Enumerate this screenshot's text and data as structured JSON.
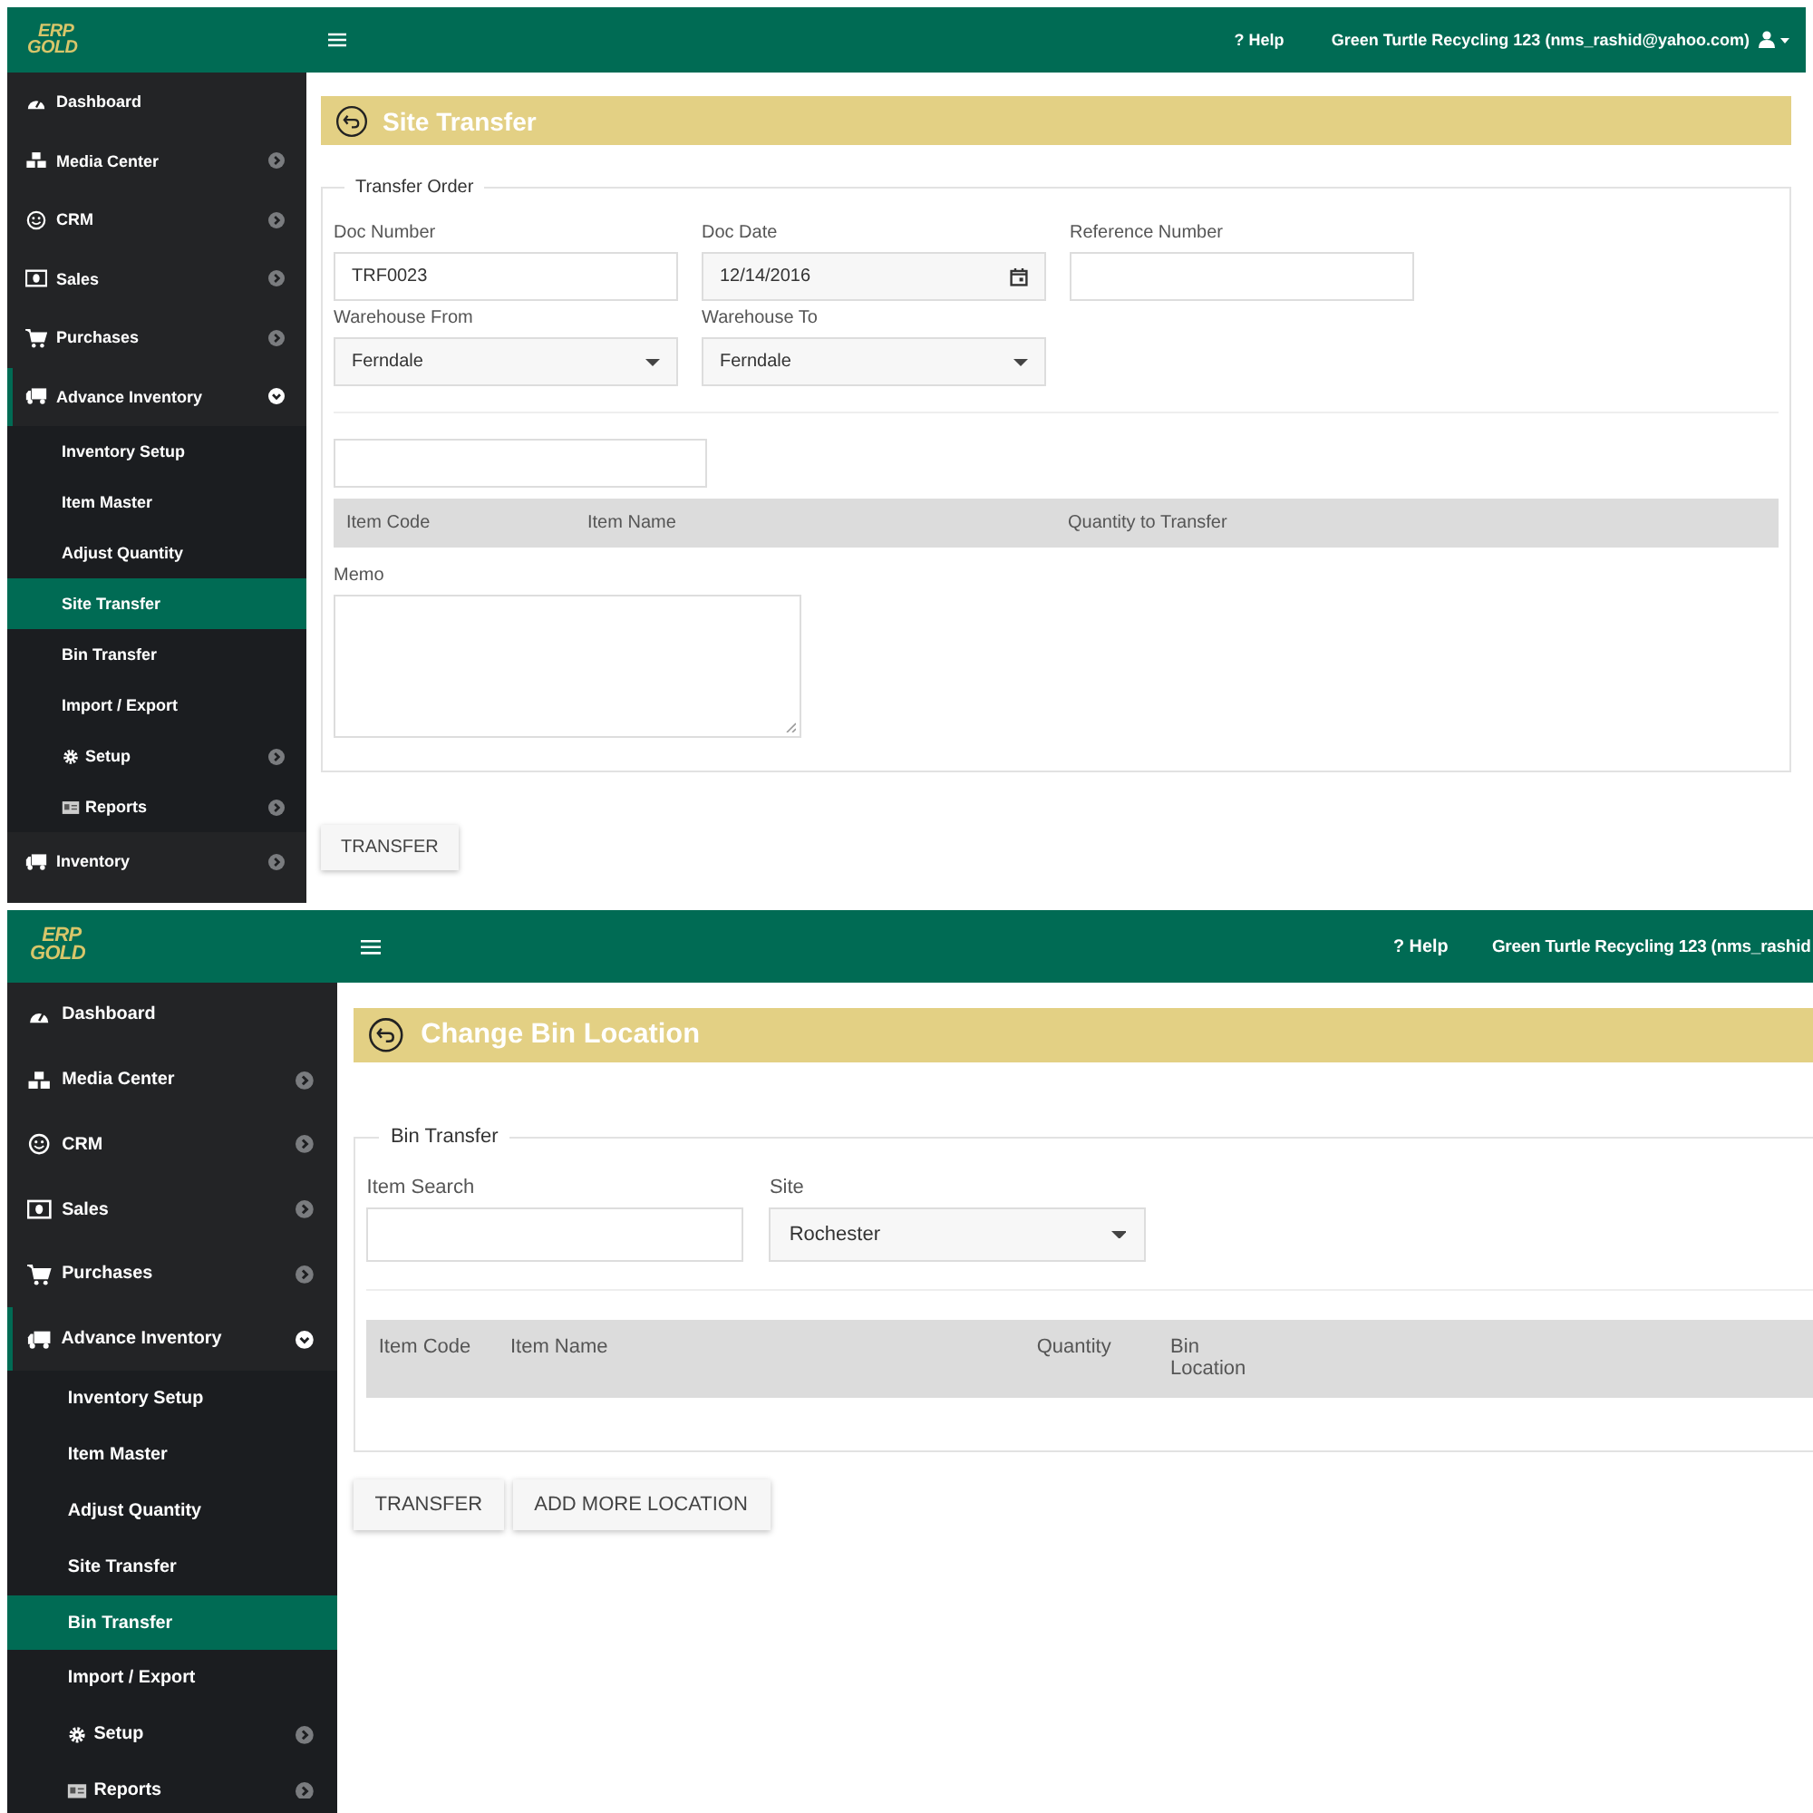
{
  "screens": [
    {
      "logo": [
        "ERP",
        "GOLD"
      ],
      "help_link": "? Help",
      "user": "Green Turtle Recycling 123 (nms_rashid@yahoo.com)",
      "account_menu": true,
      "sidebar": [
        {
          "label": "Dashboard",
          "selected": false
        },
        {
          "label": "Media Center",
          "selected": false,
          "expanded": false
        },
        {
          "label": "CRM",
          "selected": false,
          "expanded": false
        },
        {
          "label": "Sales",
          "selected": false,
          "expanded": false
        },
        {
          "label": "Purchases",
          "selected": false,
          "expanded": false
        },
        {
          "label": "Advance Inventory",
          "selected": false,
          "expanded": true,
          "children": [
            {
              "label": "Inventory Setup",
              "selected": false
            },
            {
              "label": "Item Master",
              "selected": false
            },
            {
              "label": "Adjust Quantity",
              "selected": false
            },
            {
              "label": "Site Transfer",
              "selected": true
            },
            {
              "label": "Bin Transfer",
              "selected": false
            },
            {
              "label": "Import / Export",
              "selected": false
            },
            {
              "label": "Setup",
              "selected": false,
              "expanded": false
            },
            {
              "label": "Reports",
              "selected": false,
              "expanded": false
            }
          ]
        },
        {
          "label": "Inventory",
          "selected": false,
          "expanded": false
        }
      ],
      "page_title": "Site Transfer",
      "legend": "Transfer Order",
      "blocks": [
        {
          "kind": "fields",
          "fields": [
            {
              "label": "Doc Number",
              "kind": "text",
              "value": "TRF0023"
            },
            {
              "label": "Doc Date",
              "kind": "date",
              "value": "12/14/2016"
            },
            {
              "label": "Reference Number",
              "kind": "text"
            }
          ]
        },
        {
          "kind": "fields",
          "fields": [
            {
              "label": "Warehouse From",
              "kind": "select",
              "value": "Ferndale"
            },
            {
              "label": "Warehouse To",
              "kind": "select",
              "value": "Ferndale"
            }
          ]
        },
        {
          "kind": "divider"
        },
        {
          "kind": "fields",
          "fields": [
            {
              "kind": "search"
            }
          ]
        },
        {
          "kind": "table",
          "columns": [
            "Item Code",
            "Item Name",
            "Quantity to Transfer"
          ]
        },
        {
          "kind": "fields",
          "fields": [
            {
              "label": "Memo",
              "kind": "textarea"
            }
          ]
        }
      ],
      "buttons": [
        "TRANSFER"
      ]
    },
    {
      "logo": [
        "ERP",
        "GOLD"
      ],
      "help_link": "? Help",
      "user": "Green Turtle Recycling 123 (nms_rashid",
      "account_menu": false,
      "sidebar": [
        {
          "label": "Dashboard",
          "selected": false
        },
        {
          "label": "Media Center",
          "selected": false,
          "expanded": false
        },
        {
          "label": "CRM",
          "selected": false,
          "expanded": false
        },
        {
          "label": "Sales",
          "selected": false,
          "expanded": false
        },
        {
          "label": "Purchases",
          "selected": false,
          "expanded": false
        },
        {
          "label": "Advance Inventory",
          "selected": false,
          "expanded": true,
          "children": [
            {
              "label": "Inventory Setup",
              "selected": false
            },
            {
              "label": "Item Master",
              "selected": false
            },
            {
              "label": "Adjust Quantity",
              "selected": false
            },
            {
              "label": "Site Transfer",
              "selected": false
            },
            {
              "label": "Bin Transfer",
              "selected": true
            },
            {
              "label": "Import / Export",
              "selected": false
            },
            {
              "label": "Setup",
              "selected": false,
              "expanded": false
            },
            {
              "label": "Reports",
              "selected": false,
              "expanded": false
            }
          ]
        }
      ],
      "page_title": "Change Bin Location",
      "legend": "Bin Transfer",
      "blocks": [
        {
          "kind": "fields",
          "fields": [
            {
              "label": "Item Search",
              "kind": "search"
            },
            {
              "label": "Site",
              "kind": "select",
              "value": "Rochester"
            }
          ]
        },
        {
          "kind": "divider"
        },
        {
          "kind": "table",
          "columns": [
            "Item Code",
            "Item Name",
            "Quantity",
            "Bin Location"
          ]
        }
      ],
      "buttons": [
        "TRANSFER",
        "ADD MORE LOCATION"
      ]
    }
  ]
}
